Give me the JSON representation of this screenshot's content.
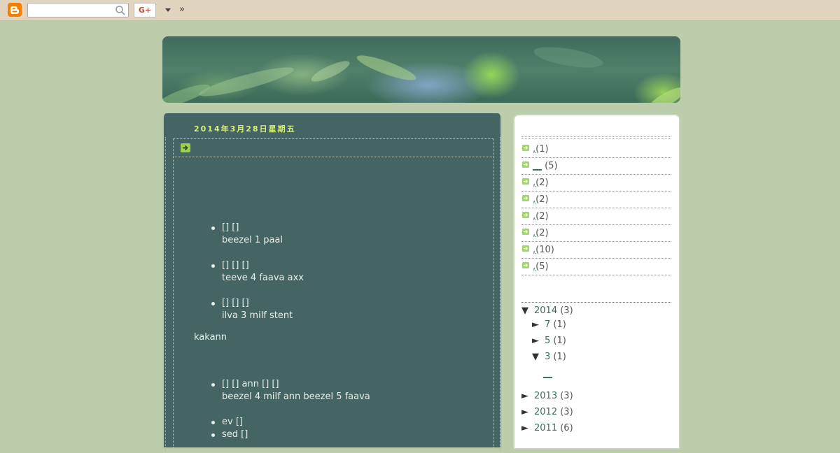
{
  "navbar": {
    "search_placeholder": "",
    "gplus_label": "G+",
    "more_label": "»"
  },
  "post": {
    "date_header": "2014年3月28日星期五",
    "body": [
      {
        "type": "li",
        "line1": "[] []",
        "line2": "beezel 1 paal"
      },
      {
        "type": "li",
        "line1": "[] [] []",
        "line2": "teeve 4 faava axx"
      },
      {
        "type": "li",
        "line1": "[] [] []",
        "line2": "ilva 3 milf stent"
      },
      {
        "type": "p",
        "text": "kakann"
      },
      {
        "type": "li",
        "line1": "[] [] ann [] []",
        "line2": "beezel 4 milf ann beezel 5 faava"
      },
      {
        "type": "li",
        "line1": "ev []",
        "line2": ""
      },
      {
        "type": "li",
        "line1": "sed []",
        "line2": ""
      }
    ]
  },
  "sidebar": {
    "labels": [
      {
        "name": ",",
        "count": "(1)"
      },
      {
        "name": "__",
        "count": "(5)"
      },
      {
        "name": ",",
        "count": "(2)"
      },
      {
        "name": ",",
        "count": "(2)"
      },
      {
        "name": ",",
        "count": "(2)"
      },
      {
        "name": ",",
        "count": "(2)"
      },
      {
        "name": ",",
        "count": "(10)"
      },
      {
        "name": ",",
        "count": "(5)"
      }
    ],
    "archive": {
      "y2014": {
        "toggle": "▼",
        "label": "2014",
        "count": "(3)"
      },
      "m7": {
        "toggle": "►",
        "label": "7",
        "count": "(1)"
      },
      "m5": {
        "toggle": "►",
        "label": "5",
        "count": "(1)"
      },
      "m3": {
        "toggle": "▼",
        "label": "3",
        "count": "(1)"
      },
      "post3": "__",
      "y2013": {
        "toggle": "►",
        "label": "2013",
        "count": "(3)"
      },
      "y2012": {
        "toggle": "►",
        "label": "2012",
        "count": "(3)"
      },
      "y2011": {
        "toggle": "►",
        "label": "2011",
        "count": "(6)"
      }
    }
  }
}
